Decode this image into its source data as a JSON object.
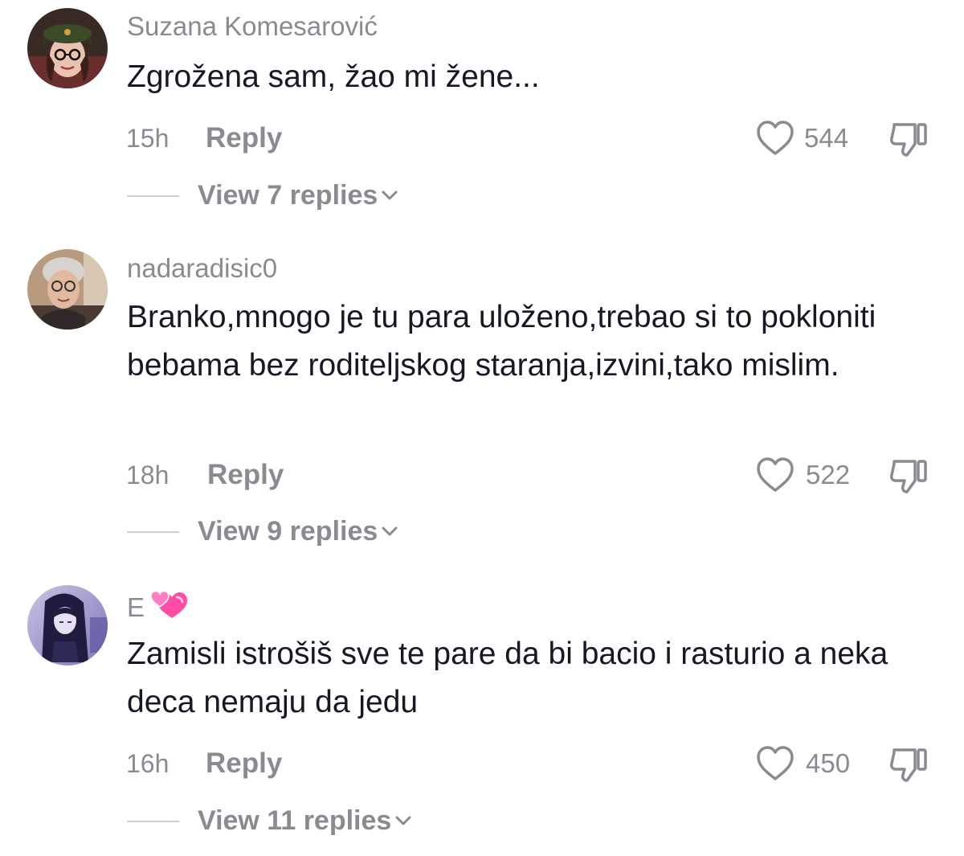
{
  "comments": [
    {
      "username": "Suzana Komesarović",
      "text": "Zgrožena sam, žao mi žene...",
      "time": "15h",
      "reply_label": "Reply",
      "likes": "544",
      "view_replies": "View 7 replies",
      "avatar_icon": "avatar-photo"
    },
    {
      "username": "nadaradisic0",
      "text": "Branko,mnogo je tu para uloženo,trebao si to pokloniti bebama bez roditeljskog staranja,izvini,tako mislim.",
      "time": "18h",
      "reply_label": "Reply",
      "likes": "522",
      "view_replies": "View 9 replies",
      "avatar_icon": "avatar-photo"
    },
    {
      "username": "E",
      "username_emoji": "two-hearts-emoji",
      "text": "Zamisli istrošiš sve te pare da bi bacio i rasturio a neka deca nemaju da jedu",
      "time": "16h",
      "reply_label": "Reply",
      "likes": "450",
      "view_replies": "View 11 replies",
      "avatar_icon": "avatar-anime"
    }
  ],
  "colors": {
    "text_primary": "#161823",
    "text_secondary": "#8a8b91",
    "divider": "#d0d0d3",
    "heart_accent": "#ff4da6"
  },
  "icons": {
    "like": "heart-outline-icon",
    "dislike": "thumbs-down-outline-icon",
    "expand": "chevron-down-icon"
  }
}
